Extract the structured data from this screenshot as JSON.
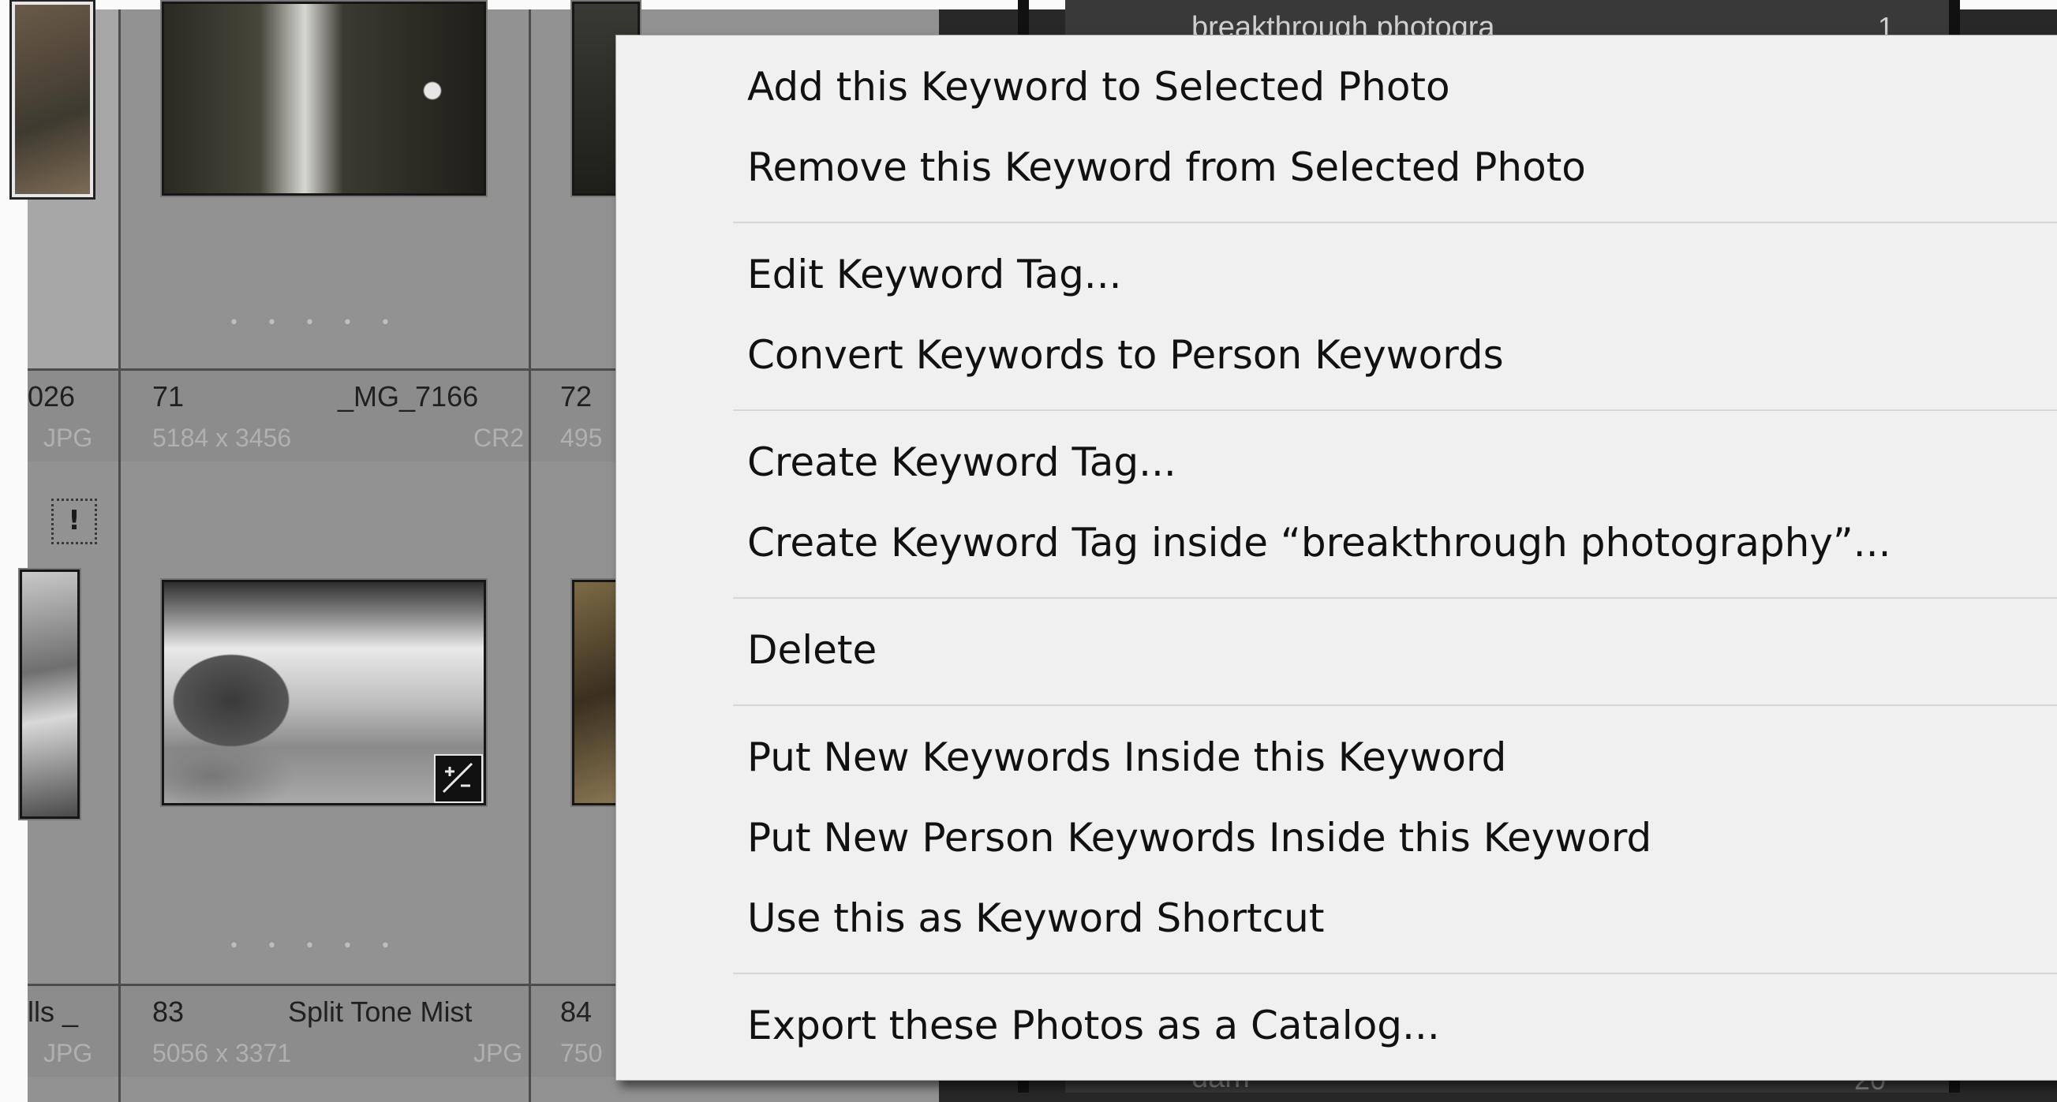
{
  "keyword_panel": {
    "top_keyword": "breakthrough photogra",
    "top_count": "1",
    "bottom_keyword": "dam",
    "bottom_count": "20"
  },
  "grid": {
    "cells_row1": [
      {
        "num": "",
        "name": "026",
        "size": "",
        "type": "JPG"
      },
      {
        "num": "71",
        "name": "_MG_7166",
        "size": "5184 x 3456",
        "type": "CR2"
      },
      {
        "num": "72",
        "name": "",
        "size": "495",
        "type": ""
      }
    ],
    "cells_row2": [
      {
        "num": "",
        "name": "lls _",
        "size": "",
        "type": "JPG"
      },
      {
        "num": "83",
        "name": "Split Tone Mist",
        "size": "5056 x 3371",
        "type": "JPG"
      },
      {
        "num": "84",
        "name": "",
        "size": "750",
        "type": ""
      }
    ],
    "flag_symbol": "!",
    "dots": "• • • • •",
    "badge_icon": "develop-adjustments-icon"
  },
  "context_menu": {
    "groups": [
      [
        "Add this Keyword to Selected Photo",
        "Remove this Keyword from Selected Photo"
      ],
      [
        "Edit Keyword Tag...",
        "Convert Keywords to Person Keywords"
      ],
      [
        "Create Keyword Tag...",
        "Create Keyword Tag inside “breakthrough photography”..."
      ],
      [
        "Delete"
      ],
      [
        "Put New Keywords Inside this Keyword",
        "Put New Person Keywords Inside this Keyword",
        "Use this as Keyword Shortcut"
      ],
      [
        "Export these Photos as a Catalog..."
      ]
    ]
  }
}
